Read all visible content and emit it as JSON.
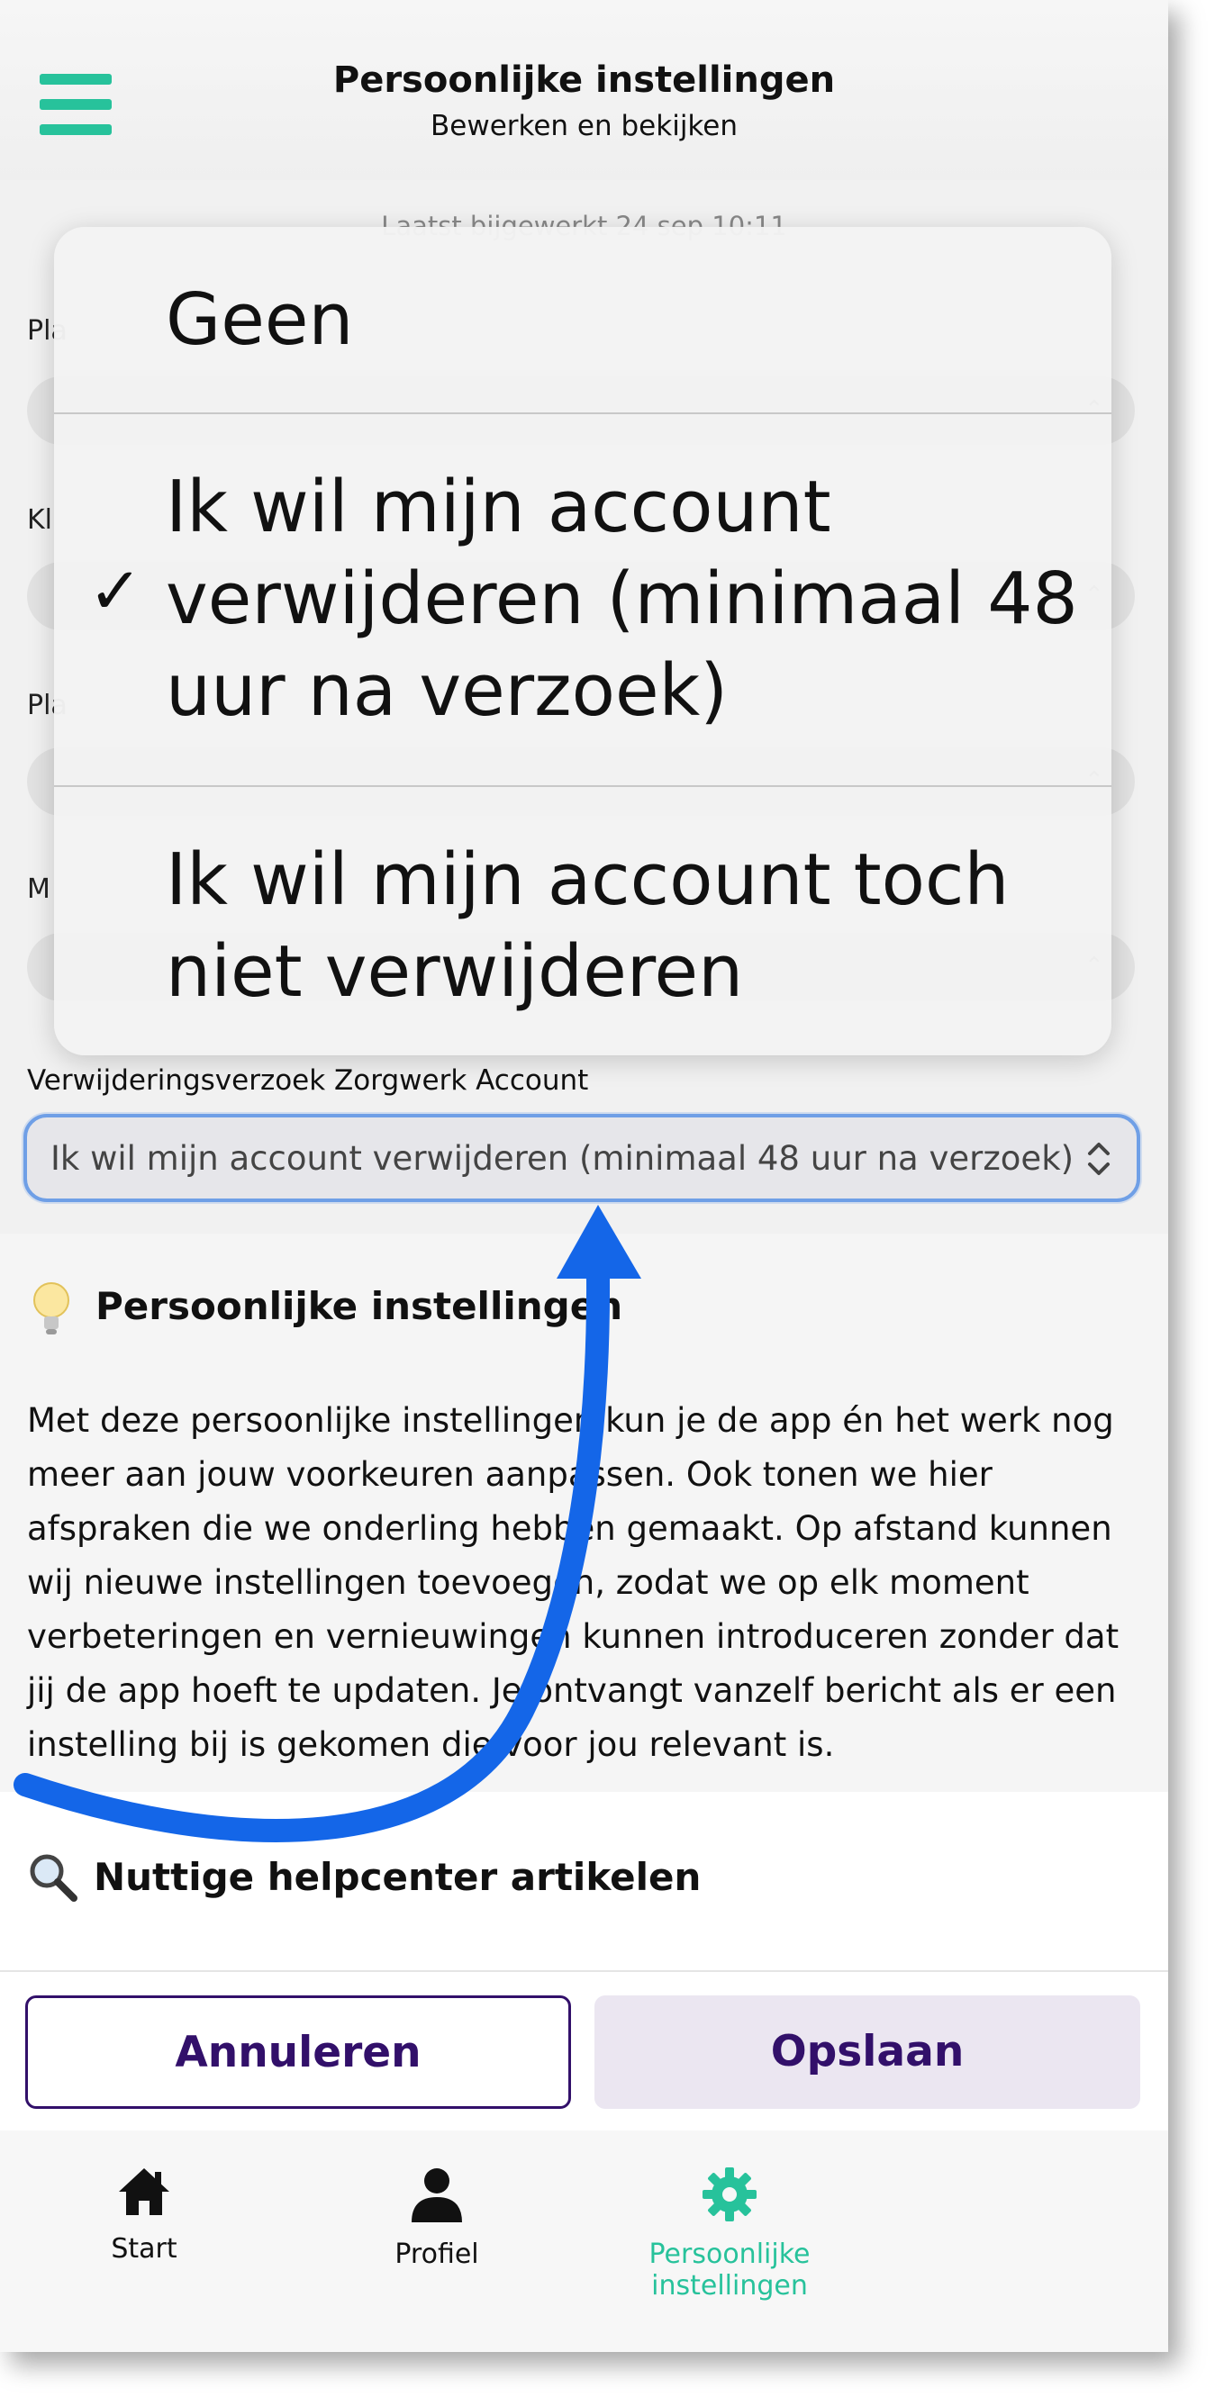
{
  "header": {
    "title": "Persoonlijke instellingen",
    "subtitle": "Bewerken en bekijken"
  },
  "background": {
    "last_updated": "Laatst bijgewerkt 24 sep 10:11",
    "label_1": "Pla",
    "label_2": "Kl",
    "label_3": "Pla",
    "label_4": "M"
  },
  "dropdown": {
    "options": [
      {
        "label": "Geen",
        "selected": false
      },
      {
        "label": "Ik wil mijn account verwijderen (minimaal 48 uur na verzoek)",
        "selected": true
      },
      {
        "label": "Ik wil mijn account toch niet verwijderen",
        "selected": false
      }
    ],
    "checkmark": "✓"
  },
  "field": {
    "label": "Verwijderingsverzoek Zorgwerk Account",
    "value": "Ik wil mijn account verwijderen (minimaal 48 uur na verzoek)"
  },
  "info": {
    "icon": "lightbulb-icon",
    "title": "Persoonlijke instellingen",
    "text": "Met deze persoonlijke instellingen kun je de app én het werk nog meer aan jouw voorkeuren aanpassen. Ook tonen we hier afspraken die we onderling hebben gemaakt. Op afstand kunnen wij nieuwe instellingen toevoegen, zodat we op elk moment verbeteringen en vernieuwingen kunnen introduceren zonder dat jij de app hoeft te updaten. Je ontvangt vanzelf bericht als er een instelling bij is gekomen die voor jou relevant is."
  },
  "help": {
    "icon": "magnifier-icon",
    "title": "Nuttige helpcenter artikelen"
  },
  "buttons": {
    "cancel": "Annuleren",
    "save": "Opslaan"
  },
  "tabs": [
    {
      "label": "Start",
      "icon": "home-icon",
      "active": false
    },
    {
      "label": "Profiel",
      "icon": "person-icon",
      "active": false
    },
    {
      "label": "Persoonlijke instellingen",
      "icon": "gear-icon",
      "active": true
    }
  ],
  "colors": {
    "accent": "#27c29b",
    "brand": "#32106a",
    "focus_border": "#6f9fe6",
    "annotation_arrow": "#1466e8"
  }
}
